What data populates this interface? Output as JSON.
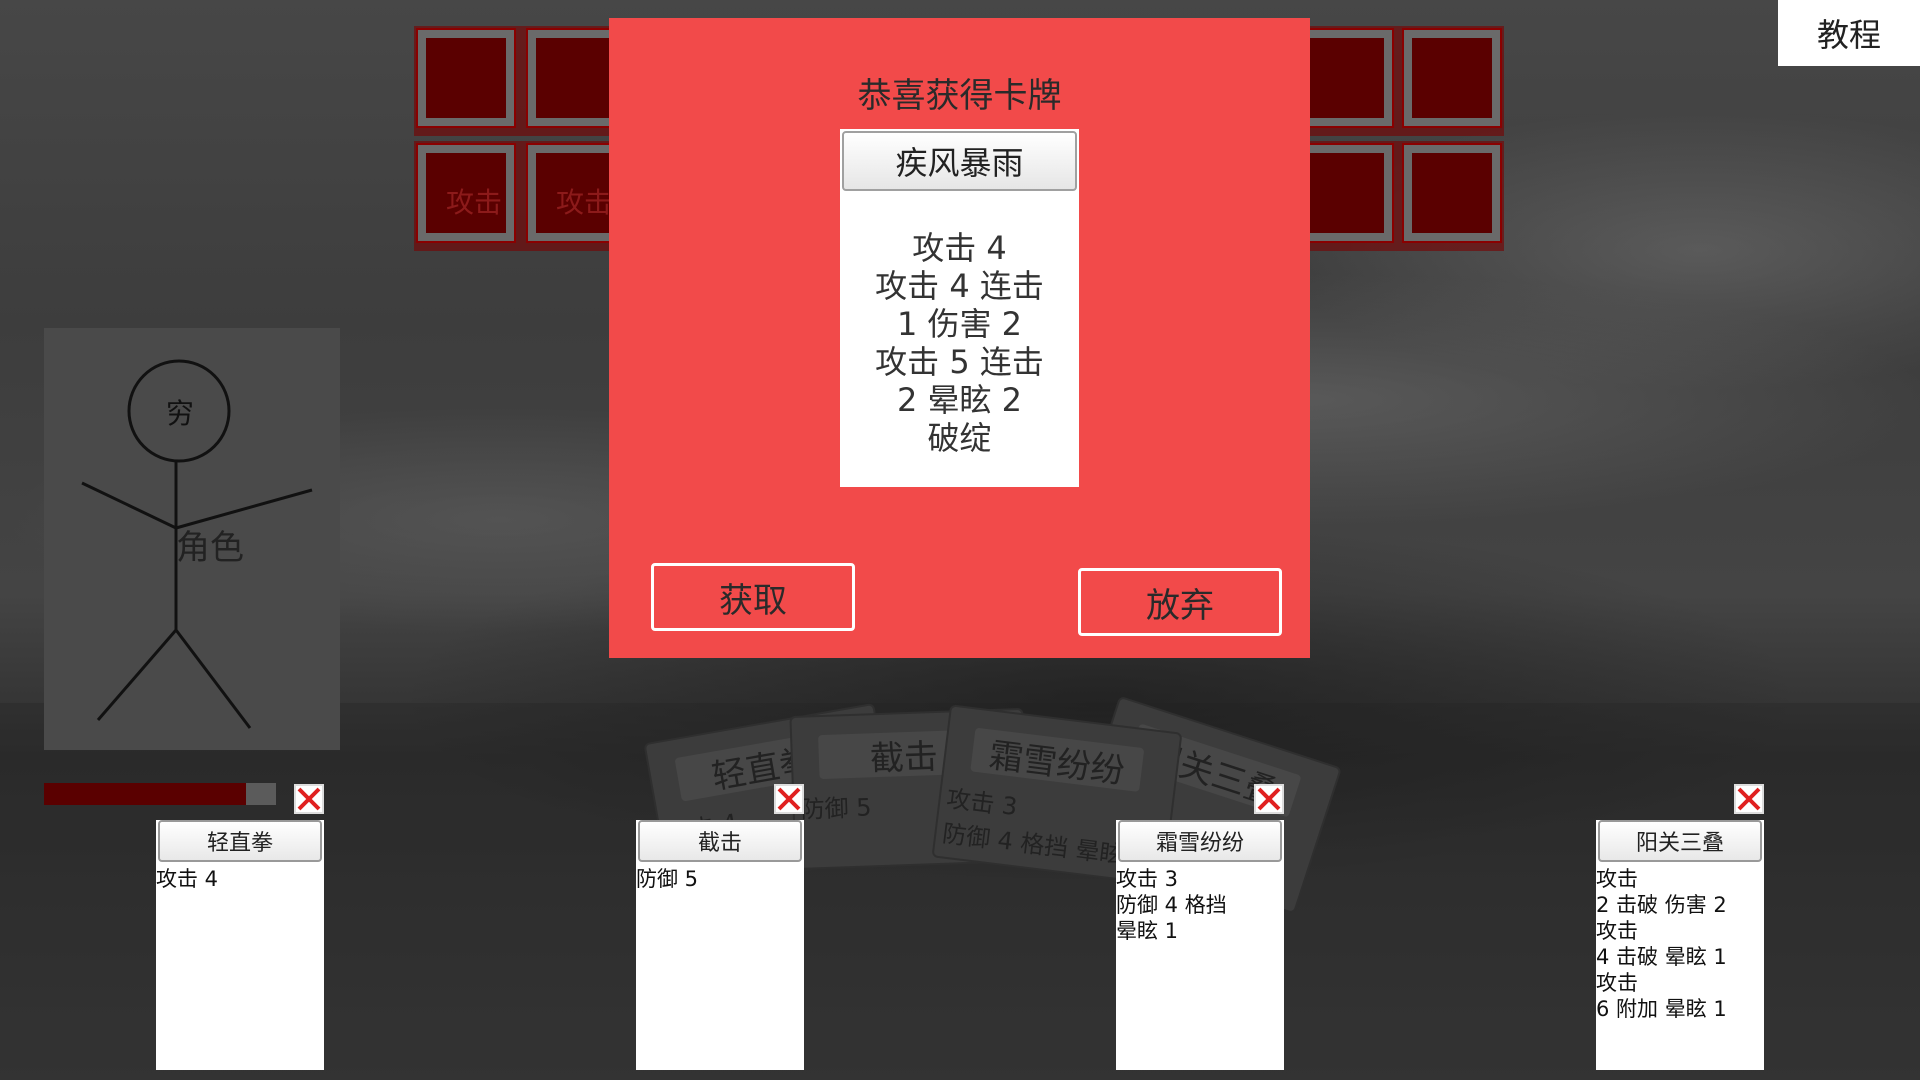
{
  "tutorial_label": "教程",
  "enemy_slots": {
    "row2_labels": [
      "攻击",
      "攻击"
    ]
  },
  "character": {
    "head_text": "穷",
    "body_text": "角色",
    "hp_fraction": 0.87
  },
  "modal": {
    "title": "恭喜获得卡牌",
    "card_name": "疾风暴雨",
    "card_effect": "攻击 4\n攻击 4 连击\n1 伤害 2\n攻击 5 连击\n2 晕眩 2\n破绽",
    "accept_label": "获取",
    "discard_label": "放弃"
  },
  "hand_cards_background": [
    {
      "title": "轻直拳",
      "text": "攻击 4"
    },
    {
      "title": "截击",
      "text": "防御 5"
    },
    {
      "title": "霜雪纷纷",
      "text": "攻击 3\n防御 4 格挡 晕眩"
    },
    {
      "title": "阳关三叠",
      "text": "攻击"
    }
  ],
  "equipped_cards": [
    {
      "title": "轻直拳",
      "text": "攻击 4"
    },
    {
      "title": "截击",
      "text": "防御 5"
    },
    {
      "title": "霜雪纷纷",
      "text": "攻击 3\n防御 4 格挡\n晕眩 1"
    },
    {
      "title": "阳关三叠",
      "text": "攻击\n2 击破 伤害 2\n攻击\n4 击破 晕眩 1\n攻击\n6 附加 晕眩 1"
    }
  ],
  "icons": {
    "remove": "close-x-icon"
  },
  "colors": {
    "modal_bg": "#f24a4a",
    "slot_red": "#5a0000",
    "remove_x": "#e02020"
  }
}
